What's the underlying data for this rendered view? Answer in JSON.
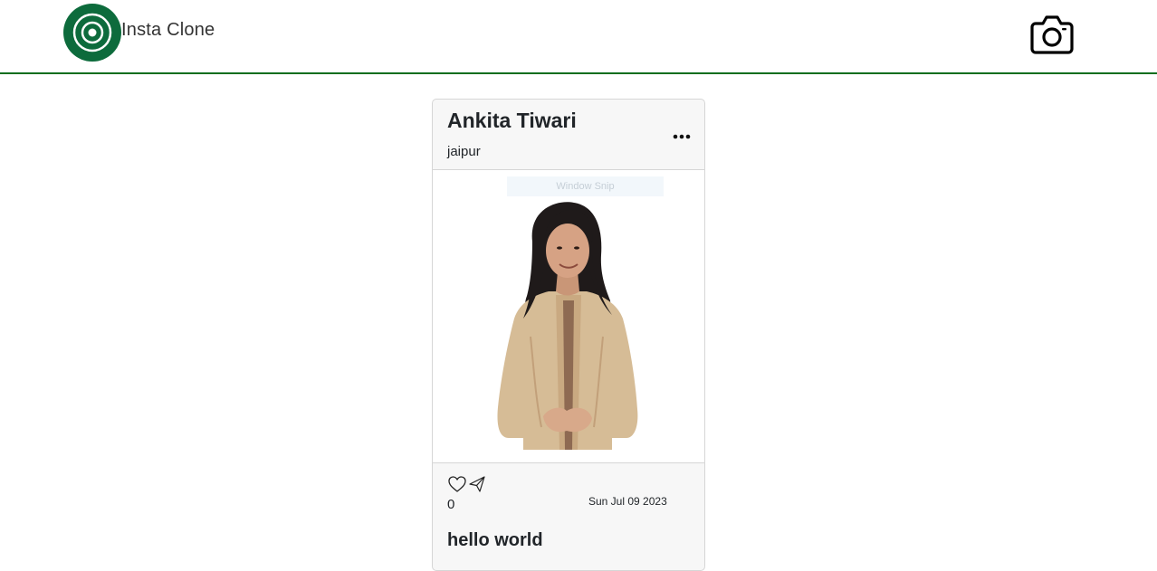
{
  "header": {
    "brand": "Insta Clone",
    "logo_icon": "target-logo-icon",
    "camera_icon": "camera-icon",
    "accent_color": "#0b6e1e",
    "logo_color": "#0d6b3c"
  },
  "post": {
    "author": "Ankita Tiwari",
    "location": "jaipur",
    "menu_icon": "three-dots-icon",
    "image_overlay_text": "Window Snip",
    "like_icon": "heart-icon",
    "share_icon": "send-icon",
    "likes": "0",
    "date": "Sun Jul 09 2023",
    "caption": "hello world"
  }
}
